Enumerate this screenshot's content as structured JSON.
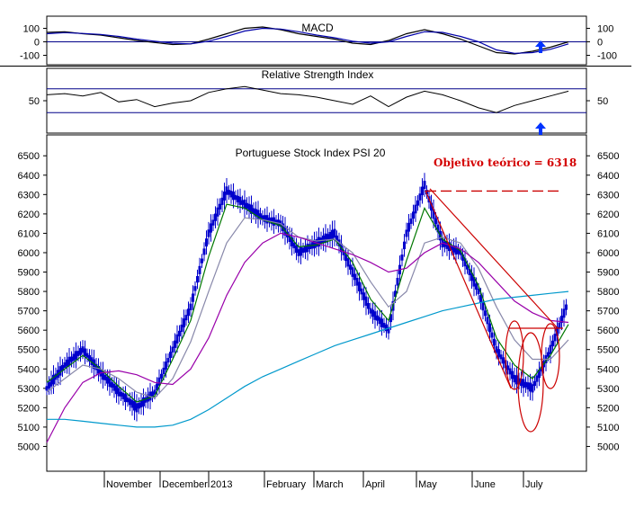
{
  "chart_data": [
    {
      "type": "line",
      "title": "MACD",
      "y_ticks": [
        100,
        0,
        -100
      ],
      "ylim": [
        -150,
        170
      ],
      "reference_line": 0,
      "x": [
        0,
        10,
        20,
        30,
        40,
        50,
        60,
        70,
        80,
        90,
        100,
        110,
        120,
        130,
        140,
        150,
        160,
        170,
        180,
        190,
        200,
        210,
        220,
        230,
        240,
        250,
        260,
        270,
        280,
        290
      ],
      "series": [
        {
          "values": [
            70,
            75,
            60,
            50,
            30,
            10,
            -5,
            -20,
            -15,
            20,
            60,
            100,
            110,
            90,
            60,
            40,
            20,
            -10,
            -20,
            10,
            60,
            90,
            60,
            20,
            -30,
            -80,
            -90,
            -70,
            -40,
            0
          ]
        },
        {
          "values": [
            60,
            68,
            62,
            55,
            40,
            20,
            5,
            -10,
            -15,
            5,
            40,
            80,
            100,
            95,
            75,
            50,
            30,
            5,
            -10,
            0,
            40,
            75,
            70,
            40,
            0,
            -60,
            -85,
            -80,
            -55,
            -15
          ]
        }
      ],
      "arrow_color": "#0033ff"
    },
    {
      "type": "line",
      "title": "Relative Strength Index",
      "y_ticks": [
        50
      ],
      "ylim": [
        0,
        100
      ],
      "levels": [
        70,
        30
      ],
      "x": [
        0,
        10,
        20,
        30,
        40,
        50,
        60,
        70,
        80,
        90,
        100,
        110,
        120,
        130,
        140,
        150,
        160,
        170,
        180,
        190,
        200,
        210,
        220,
        230,
        240,
        250,
        260,
        270,
        280,
        290
      ],
      "series": [
        {
          "values": [
            60,
            62,
            58,
            64,
            48,
            52,
            40,
            46,
            50,
            64,
            70,
            74,
            68,
            62,
            60,
            56,
            50,
            44,
            58,
            40,
            56,
            66,
            60,
            50,
            38,
            30,
            42,
            50,
            58,
            66
          ]
        }
      ],
      "arrow_color": "#0033ff"
    },
    {
      "type": "line",
      "title": "Portuguese Stock Index PSI 20",
      "y_ticks": [
        5000,
        5100,
        5200,
        5300,
        5400,
        5500,
        5600,
        5700,
        5800,
        5900,
        6000,
        6100,
        6200,
        6300,
        6400,
        6500
      ],
      "ylim": [
        4900,
        6580
      ],
      "x_ticks": [
        "November",
        "December",
        "2013",
        "February",
        "March",
        "April",
        "May",
        "June",
        "July"
      ],
      "x": [
        0,
        10,
        20,
        30,
        40,
        50,
        60,
        70,
        80,
        90,
        100,
        110,
        120,
        130,
        140,
        150,
        160,
        170,
        180,
        190,
        200,
        210,
        220,
        230,
        240,
        250,
        260,
        270,
        280,
        290
      ],
      "series": [
        {
          "name": "",
          "style": "candles",
          "values": [
            5300,
            5420,
            5500,
            5380,
            5280,
            5200,
            5280,
            5500,
            5720,
            6100,
            6320,
            6250,
            6180,
            6150,
            6000,
            6050,
            6100,
            5900,
            5700,
            5600,
            6100,
            6350,
            6050,
            6000,
            5800,
            5500,
            5350,
            5300,
            5500,
            5750
          ],
          "color": "#0000cc"
        },
        {
          "name": "",
          "values": [
            5330,
            5400,
            5470,
            5400,
            5310,
            5230,
            5260,
            5450,
            5650,
            5980,
            6250,
            6230,
            6170,
            6140,
            6030,
            6040,
            6070,
            5950,
            5760,
            5650,
            5960,
            6230,
            6070,
            6010,
            5830,
            5560,
            5420,
            5350,
            5470,
            5630
          ],
          "color": "#007700"
        },
        {
          "name": "",
          "values": [
            5280,
            5350,
            5420,
            5400,
            5350,
            5280,
            5250,
            5350,
            5540,
            5800,
            6050,
            6180,
            6170,
            6150,
            6080,
            6060,
            6070,
            6000,
            5850,
            5720,
            5800,
            6050,
            6080,
            6050,
            5920,
            5720,
            5550,
            5450,
            5450,
            5550
          ],
          "color": "#8888aa"
        },
        {
          "name": "",
          "values": [
            5020,
            5200,
            5330,
            5380,
            5390,
            5370,
            5330,
            5320,
            5400,
            5560,
            5780,
            5950,
            6050,
            6100,
            6080,
            6050,
            6020,
            5990,
            5950,
            5900,
            5920,
            6000,
            6050,
            6020,
            5950,
            5850,
            5750,
            5690,
            5650,
            5640
          ],
          "color": "#9900aa"
        },
        {
          "name": "",
          "values": [
            5140,
            5140,
            5130,
            5120,
            5110,
            5100,
            5100,
            5110,
            5140,
            5190,
            5250,
            5310,
            5360,
            5400,
            5440,
            5480,
            5520,
            5550,
            5580,
            5610,
            5640,
            5670,
            5700,
            5720,
            5740,
            5760,
            5770,
            5780,
            5790,
            5800
          ],
          "color": "#0099cc"
        }
      ],
      "annotations": [
        "Objetivo teórico = 6318"
      ],
      "target_level": 6318,
      "resistance_level": 5610,
      "annotation_color": "#cc0000"
    }
  ]
}
